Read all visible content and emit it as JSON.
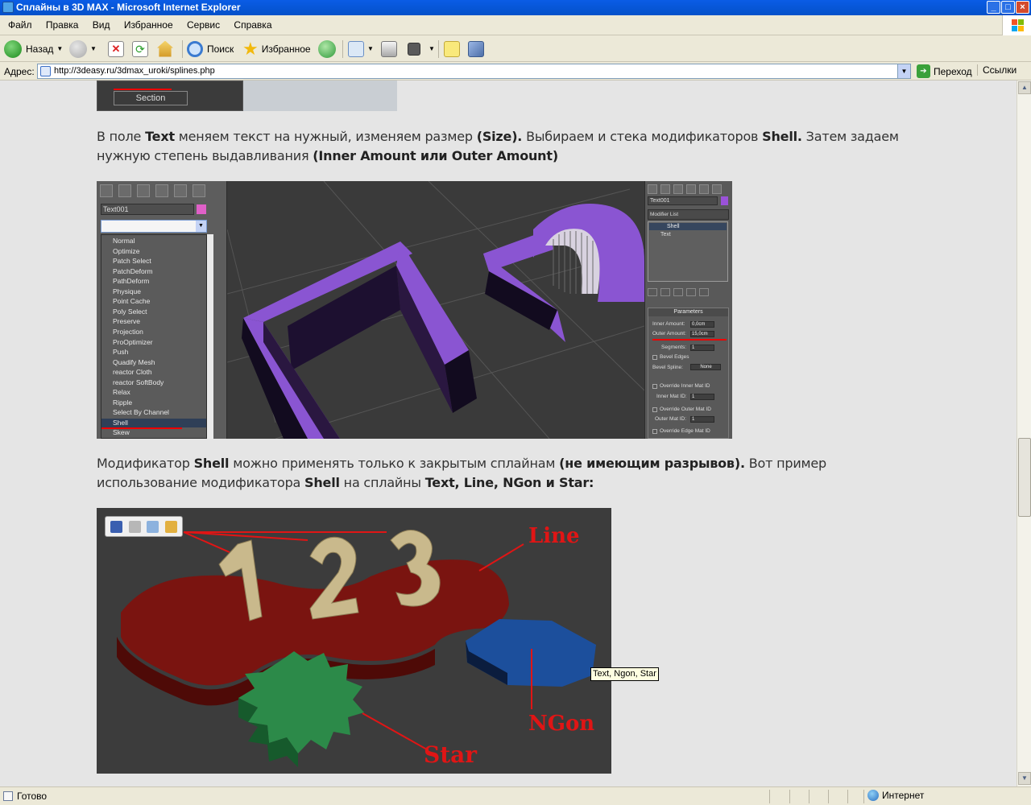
{
  "window": {
    "title": "Сплайны в 3D MAX - Microsoft Internet Explorer",
    "minimize": "_",
    "maximize": "□",
    "close": "×"
  },
  "menu": [
    "Файл",
    "Правка",
    "Вид",
    "Избранное",
    "Сервис",
    "Справка"
  ],
  "toolbar": {
    "back": "Назад",
    "search": "Поиск",
    "favorites": "Избранное"
  },
  "address": {
    "label": "Адрес:",
    "url": "http://3deasy.ru/3dmax_uroki/splines.php",
    "go": "Переход",
    "links": "Ссылки"
  },
  "status": {
    "text": "Готово",
    "zone": "Интернет"
  },
  "tooltip": "Text, Ngon, Star",
  "image_top": {
    "section_label": "Section"
  },
  "image_text_panel": {
    "object_name": "Text001",
    "modifiers": [
      "Normal",
      "Optimize",
      "Patch Select",
      "PatchDeform",
      "PathDeform",
      "Physique",
      "Point Cache",
      "Poly Select",
      "Preserve",
      "Projection",
      "ProOptimizer",
      "Push",
      "Quadify Mesh",
      "reactor Cloth",
      "reactor SoftBody",
      "Relax",
      "Ripple",
      "Select By Channel",
      "Shell",
      "Skew"
    ],
    "selected_modifier": "Shell",
    "right": {
      "object_name": "Text001",
      "modifier_list": "Modifier List",
      "stack_top": "Shell",
      "stack_base": "Text",
      "params_title": "Parameters",
      "inner_amount_label": "Inner Amount:",
      "inner_amount_value": "0,0cm",
      "outer_amount_label": "Outer Amount:",
      "outer_amount_value": "15,0cm",
      "segments_label": "Segments:",
      "segments_value": "1",
      "bevel_edges": "Bevel Edges",
      "bevel_spline_label": "Bevel Spline:",
      "bevel_spline_value": "None",
      "override_inner": "Override Inner Mat ID",
      "inner_mat_id": "Inner Mat ID:",
      "inner_mat_value": "1",
      "override_outer": "Override Outer Mat ID",
      "outer_mat_id": "Outer Mat ID:",
      "outer_mat_value": "1",
      "override_edge": "Override Edge Mat ID"
    }
  },
  "image_shapes": {
    "digits": [
      "1",
      "2",
      "3"
    ],
    "label_line": "Line",
    "label_ngon": "NGon",
    "label_star": "Star"
  },
  "colors": {
    "text_purple": "#8a55d2",
    "line_red": "#8c1a14",
    "ngon_blue": "#1c4f9c",
    "star_green": "#2c8a49",
    "annotation_red": "#e01515"
  }
}
